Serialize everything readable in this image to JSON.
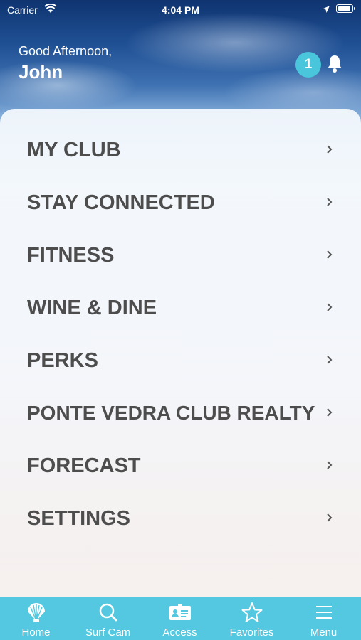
{
  "status_bar": {
    "carrier": "Carrier",
    "time": "4:04 PM",
    "battery_level": 1.0
  },
  "header": {
    "greeting": "Good Afternoon,",
    "user_name": "John",
    "notification_count": "1"
  },
  "menu": {
    "items": [
      {
        "label": "MY CLUB"
      },
      {
        "label": "STAY CONNECTED"
      },
      {
        "label": "FITNESS"
      },
      {
        "label": "WINE & DINE"
      },
      {
        "label": "PERKS"
      },
      {
        "label": "PONTE VEDRA CLUB REALTY"
      },
      {
        "label": "FORECAST"
      },
      {
        "label": "SETTINGS"
      }
    ]
  },
  "tab_bar": {
    "tabs": [
      {
        "label": "Home",
        "icon": "shell-icon"
      },
      {
        "label": "Surf Cam",
        "icon": "search-icon"
      },
      {
        "label": "Access",
        "icon": "id-card-icon"
      },
      {
        "label": "Favorites",
        "icon": "star-icon"
      },
      {
        "label": "Menu",
        "icon": "hamburger-menu-icon"
      }
    ]
  },
  "colors": {
    "accent": "#54c8e0",
    "badge": "#49c6dc",
    "menu_text": "#4d4d4d"
  }
}
